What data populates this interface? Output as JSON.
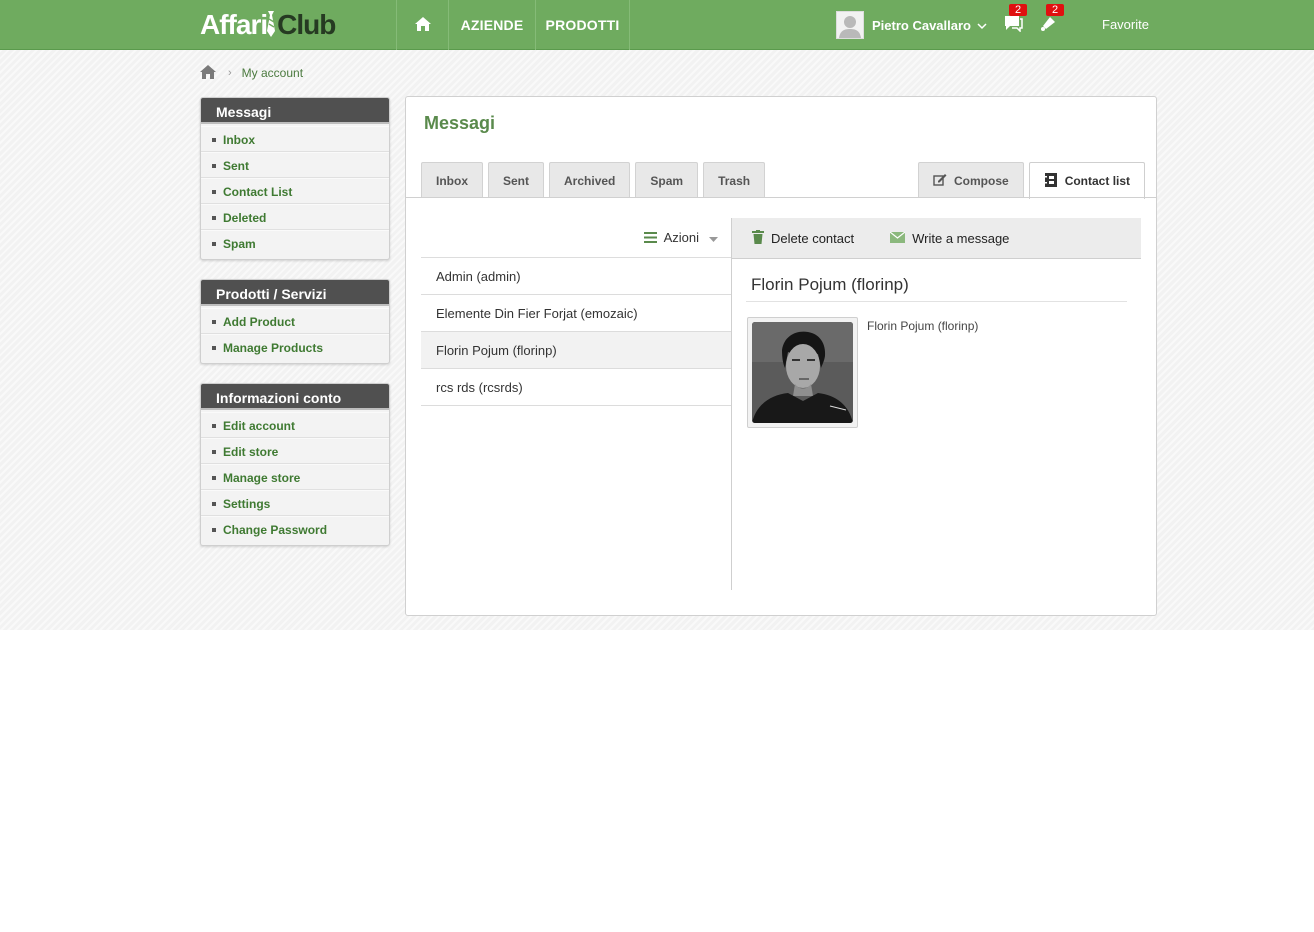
{
  "brand": {
    "part1": "Affari",
    "part2": "Club"
  },
  "nav": {
    "aziende": "AZIENDE",
    "prodotti": "PRODOTTI"
  },
  "user": {
    "name": "Pietro Cavallaro"
  },
  "badges": {
    "messages": "2",
    "notifications": "2"
  },
  "header": {
    "favorite": "Favorite"
  },
  "breadcrumb": {
    "current": "My account"
  },
  "sidebar": {
    "messaggi": {
      "title": "Messagi",
      "items": [
        "Inbox",
        "Sent",
        "Contact List",
        "Deleted",
        "Spam"
      ]
    },
    "prodotti": {
      "title": "Prodotti / Servizi",
      "items": [
        "Add Product",
        "Manage Products"
      ]
    },
    "conto": {
      "title": "Informazioni conto",
      "items": [
        "Edit account",
        "Edit store",
        "Manage store",
        "Settings",
        "Change Password"
      ]
    }
  },
  "main": {
    "title": "Messagi",
    "tabs": [
      "Inbox",
      "Sent",
      "Archived",
      "Spam",
      "Trash"
    ],
    "compose_label": "Compose",
    "contact_list_label": "Contact list",
    "actions_label": "Azioni",
    "contacts": [
      "Admin (admin)",
      "Elemente Din Fier Forjat (emozaic)",
      "Florin Pojum (florinp)",
      "rcs rds (rcsrds)"
    ],
    "selected_contact_index": 2,
    "toolbar": {
      "delete_label": "Delete contact",
      "write_label": "Write a message"
    },
    "detail": {
      "name": "Florin Pojum (florinp)",
      "caption": "Florin Pojum (florinp)"
    }
  },
  "colors": {
    "brand_green": "#6fab5f",
    "link_green": "#3f7a32",
    "title_green": "#5a8a4c",
    "badge_red": "#e01010",
    "sidebar_header": "#505050"
  }
}
